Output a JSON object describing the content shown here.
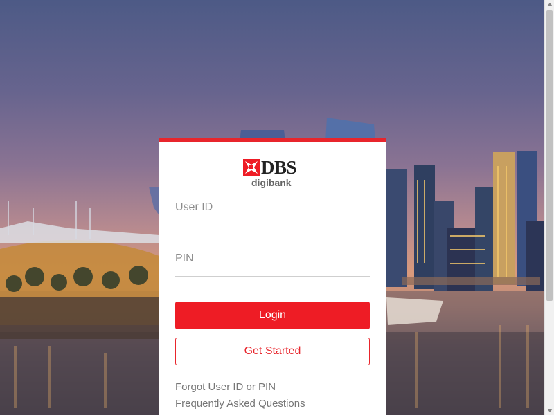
{
  "brand": {
    "name": "DBS",
    "product": "digibank",
    "accent": "#ee1c25"
  },
  "login_form": {
    "user_id_placeholder": "User ID",
    "pin_placeholder": "PIN",
    "login_label": "Login",
    "get_started_label": "Get Started"
  },
  "links": {
    "forgot": "Forgot User ID or PIN",
    "faq": "Frequently Asked Questions"
  }
}
